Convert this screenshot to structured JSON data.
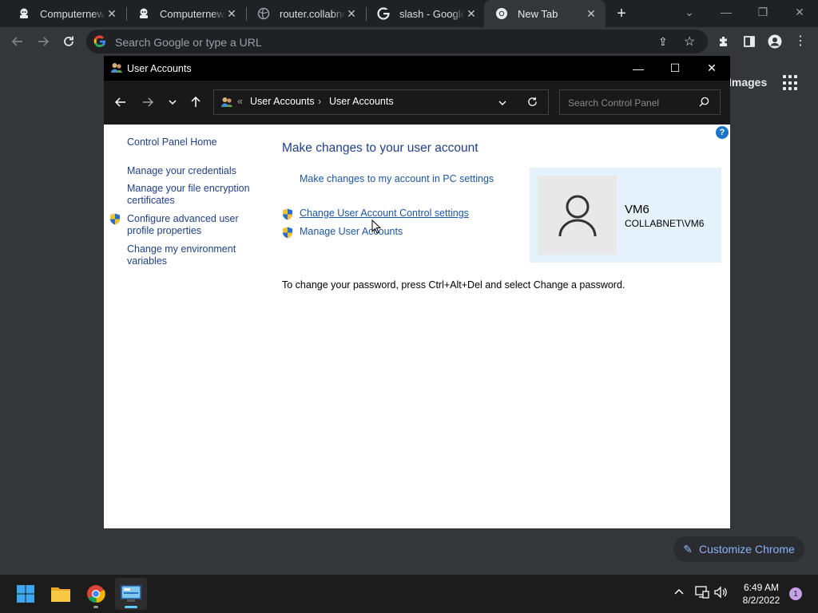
{
  "chrome": {
    "tabs": [
      {
        "title": "Computernewb",
        "icon": "computernewb-favicon-icon",
        "active": false
      },
      {
        "title": "Computernewb",
        "icon": "computernewb-favicon-icon",
        "active": false
      },
      {
        "title": "router.collabnet",
        "icon": "globe-icon",
        "active": false
      },
      {
        "title": "slash - Google S",
        "icon": "google-icon",
        "active": false
      },
      {
        "title": "New Tab",
        "icon": "chrome-icon",
        "active": true
      }
    ],
    "omnibox_placeholder": "Search Google or type a URL",
    "ntp": {
      "images_link": "Images",
      "customize_label": "Customize Chrome"
    }
  },
  "dialog": {
    "title": "User Accounts",
    "breadcrumb": [
      "User Accounts",
      "User Accounts"
    ],
    "breadcrumb_prefix": "«",
    "breadcrumb_separator": "›",
    "search_placeholder": "Search Control Panel",
    "help_label": "?",
    "sidebar": [
      {
        "label": "Control Panel Home",
        "shield": false
      },
      {
        "label": "Manage your credentials",
        "shield": false
      },
      {
        "label": "Manage your file encryption certificates",
        "shield": false
      },
      {
        "label": "Configure advanced user profile properties",
        "shield": true
      },
      {
        "label": "Change my environment variables",
        "shield": false
      }
    ],
    "heading": "Make changes to your user account",
    "links": [
      {
        "label": "Make changes to my account in PC settings",
        "shield": false
      },
      {
        "label": "Change User Account Control settings",
        "shield": true
      },
      {
        "label": "Manage User Accounts",
        "shield": true
      }
    ],
    "user": {
      "name": "VM6",
      "domain": "COLLABNET\\VM6"
    },
    "password_note": "To change your password, press Ctrl+Alt+Del and select Change a password."
  },
  "taskbar": {
    "time": "6:49 AM",
    "date": "8/2/2022",
    "notification_count": "1"
  },
  "colors": {
    "accent_blue": "#1a56a8",
    "chrome_dark": "#202124",
    "taskbar": "#1c1c1c"
  }
}
